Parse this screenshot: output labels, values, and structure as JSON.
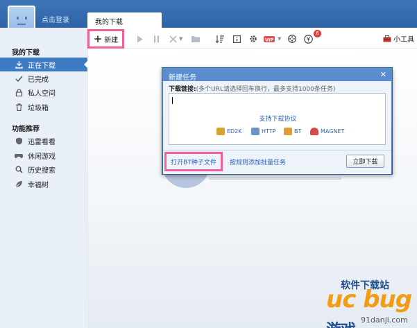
{
  "header": {
    "login_text": "点击登录",
    "tab_label": "我的下载"
  },
  "sidebar": {
    "section1_title": "我的下载",
    "items1": [
      {
        "label": "正在下载",
        "icon": "download-icon",
        "active": true
      },
      {
        "label": "已完成",
        "icon": "check-icon"
      },
      {
        "label": "私人空间",
        "icon": "lock-icon"
      },
      {
        "label": "垃圾箱",
        "icon": "trash-icon"
      }
    ],
    "section2_title": "功能推荐",
    "items2": [
      {
        "label": "迅雷看看",
        "icon": "shield-icon"
      },
      {
        "label": "休闲游戏",
        "icon": "gamepad-icon"
      },
      {
        "label": "历史搜索",
        "icon": "search-icon"
      },
      {
        "label": "幸福树",
        "icon": "leaf-icon"
      }
    ]
  },
  "toolbar": {
    "new_label": "新建",
    "tools_label": "小工具",
    "vip_label": "VIP",
    "notification_count": "6"
  },
  "dialog": {
    "title": "新建任务",
    "link_label": "下载链接:",
    "link_hint": "(多个URL请选择回车换行，最多支持1000条任务)",
    "protocols_title": "支持下载协议",
    "protocols": [
      {
        "label": "ED2K",
        "color": "#d9a330"
      },
      {
        "label": "HTTP",
        "color": "#6b93c9"
      },
      {
        "label": "BT",
        "color": "#e39a3b"
      },
      {
        "label": "MAGNET",
        "color": "#d54b4b"
      }
    ],
    "open_bt_label": "打开BT种子文件",
    "batch_label": "按规则添加批量任务",
    "download_now_label": "立即下载"
  },
  "watermark": {
    "brand_top": "软件下载站",
    "brand_big": "uc bug",
    "brand_cn": "游戏",
    "site": "91danji.com"
  },
  "colors": {
    "header_bg": "#3d74b8",
    "active_item": "#3f7ac4",
    "highlight_border": "#f0609a",
    "link": "#2a62b5"
  }
}
